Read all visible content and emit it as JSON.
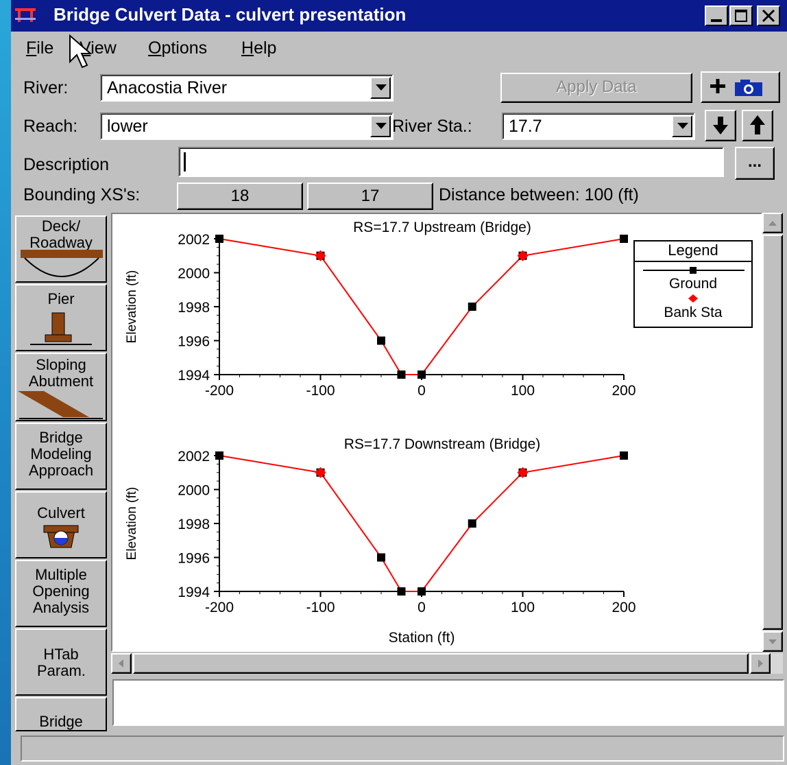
{
  "window": {
    "title": "Bridge Culvert Data - culvert presentation"
  },
  "menu": [
    {
      "label": "File"
    },
    {
      "label": "View"
    },
    {
      "label": "Options"
    },
    {
      "label": "Help"
    }
  ],
  "form": {
    "river_label": "River:",
    "river_value": "Anacostia River",
    "reach_label": "Reach:",
    "reach_value": "lower",
    "river_sta_label": "River Sta.:",
    "river_sta_value": "17.7",
    "apply_button": "Apply Data",
    "description_label": "Description",
    "description_value": "",
    "ellipsis_button": "...",
    "bounding_label": "Bounding XS's:",
    "bounding_1": "18",
    "bounding_2": "17",
    "distance_text": "Distance between: 100 (ft)"
  },
  "sidebar": [
    {
      "label": "Deck/ Roadway",
      "icon": "deck-roadway-icon"
    },
    {
      "label": "Pier",
      "icon": "pier-icon"
    },
    {
      "label": "Sloping Abutment",
      "icon": "sloping-abutment-icon"
    },
    {
      "label": "Bridge Modeling Approach",
      "icon": ""
    },
    {
      "label": "Culvert",
      "icon": "culvert-icon"
    },
    {
      "label": "Multiple Opening Analysis",
      "icon": ""
    },
    {
      "label": "HTab Param.",
      "icon": ""
    },
    {
      "label": "Bridge",
      "icon": ""
    }
  ],
  "legend": {
    "title": "Legend",
    "ground": "Ground",
    "bank": "Bank Sta"
  },
  "colors": {
    "ground": "#000000",
    "line": "#ff0000",
    "bank": "#ff0000",
    "titlebar": "#0b1a8c"
  },
  "chart_data": [
    {
      "type": "line",
      "title": "RS=17.7    Upstream  (Bridge)",
      "ylabel": "Elevation (ft)",
      "xlabel": "",
      "xlim": [
        -200,
        200
      ],
      "ylim": [
        1994,
        2002
      ],
      "xticks": [
        -200,
        -100,
        0,
        100,
        200
      ],
      "yticks": [
        1994,
        1996,
        1998,
        2000,
        2002
      ],
      "series": [
        {
          "name": "Ground",
          "x": [
            -200,
            -100,
            -40,
            -20,
            0,
            50,
            100,
            200
          ],
          "y": [
            2002,
            2001,
            1996,
            1994,
            1994,
            1998,
            2001,
            2002
          ]
        },
        {
          "name": "Bank Sta",
          "x": [
            -100,
            100
          ],
          "y": [
            2001,
            2001
          ]
        }
      ]
    },
    {
      "type": "line",
      "title": "RS=17.7    Downstream  (Bridge)",
      "ylabel": "Elevation (ft)",
      "xlabel": "Station (ft)",
      "xlim": [
        -200,
        200
      ],
      "ylim": [
        1994,
        2002
      ],
      "xticks": [
        -200,
        -100,
        0,
        100,
        200
      ],
      "yticks": [
        1994,
        1996,
        1998,
        2000,
        2002
      ],
      "series": [
        {
          "name": "Ground",
          "x": [
            -200,
            -100,
            -40,
            -20,
            0,
            50,
            100,
            200
          ],
          "y": [
            2002,
            2001,
            1996,
            1994,
            1994,
            1998,
            2001,
            2002
          ]
        },
        {
          "name": "Bank Sta",
          "x": [
            -100,
            100
          ],
          "y": [
            2001,
            2001
          ]
        }
      ]
    }
  ]
}
